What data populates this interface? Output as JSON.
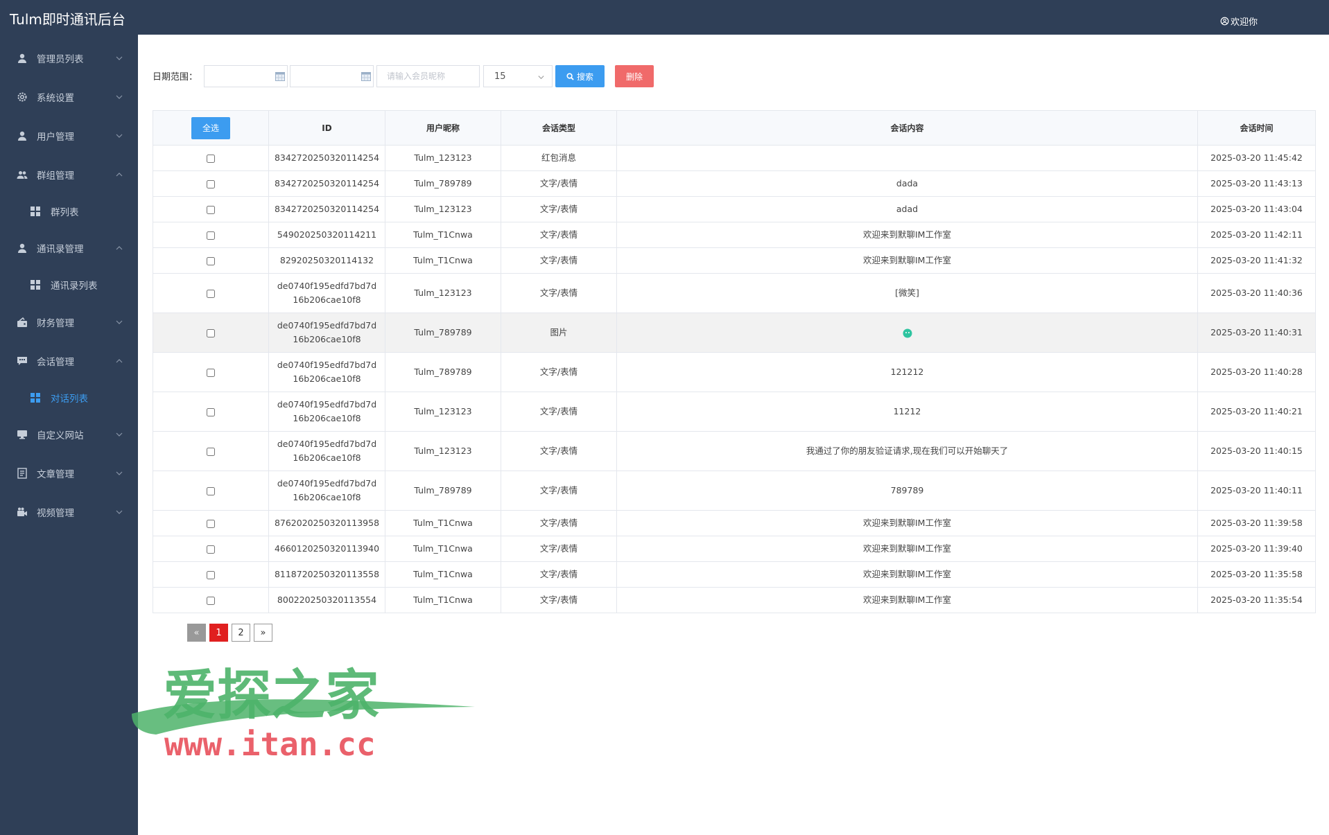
{
  "header": {
    "title": "Tulm即时通讯后台",
    "welcome": "欢迎你"
  },
  "sidebar": {
    "items": [
      {
        "label": "管理员列表",
        "icon": "user-icon",
        "expanded": false
      },
      {
        "label": "系统设置",
        "icon": "gear-icon",
        "expanded": false
      },
      {
        "label": "用户管理",
        "icon": "user-icon",
        "expanded": false
      },
      {
        "label": "群组管理",
        "icon": "group-icon",
        "expanded": true
      },
      {
        "label": "群列表",
        "icon": "grid-icon",
        "sub": true
      },
      {
        "label": "通讯录管理",
        "icon": "user-icon",
        "expanded": true
      },
      {
        "label": "通讯录列表",
        "icon": "grid-icon",
        "sub": true
      },
      {
        "label": "财务管理",
        "icon": "finance-icon",
        "expanded": false
      },
      {
        "label": "会话管理",
        "icon": "chat-icon",
        "expanded": true
      },
      {
        "label": "对话列表",
        "icon": "grid-icon",
        "sub": true,
        "active": true
      },
      {
        "label": "自定义网站",
        "icon": "monitor-icon",
        "expanded": false
      },
      {
        "label": "文章管理",
        "icon": "article-icon",
        "expanded": false
      },
      {
        "label": "视频管理",
        "icon": "video-icon",
        "expanded": false
      }
    ]
  },
  "filter": {
    "date_label": "日期范围：",
    "date_start": "",
    "date_end": "",
    "nickname_placeholder": "请输入会员昵称",
    "page_size": "15",
    "search_label": "搜索",
    "delete_label": "删除"
  },
  "table": {
    "select_all_label": "全选",
    "columns": [
      "ID",
      "用户昵称",
      "会话类型",
      "会话内容",
      "会话时间"
    ],
    "rows": [
      {
        "id": "8342720250320114254",
        "nickname": "Tulm_123123",
        "type": "红包消息",
        "content": "",
        "time": "2025-03-20 11:45:42"
      },
      {
        "id": "8342720250320114254",
        "nickname": "Tulm_789789",
        "type": "文字/表情",
        "content": "dada",
        "time": "2025-03-20 11:43:13"
      },
      {
        "id": "8342720250320114254",
        "nickname": "Tulm_123123",
        "type": "文字/表情",
        "content": "adad",
        "time": "2025-03-20 11:43:04"
      },
      {
        "id": "549020250320114211",
        "nickname": "Tulm_T1Cnwa",
        "type": "文字/表情",
        "content": "欢迎来到默聊IM工作室",
        "time": "2025-03-20 11:42:11"
      },
      {
        "id": "82920250320114132",
        "nickname": "Tulm_T1Cnwa",
        "type": "文字/表情",
        "content": "欢迎来到默聊IM工作室",
        "time": "2025-03-20 11:41:32"
      },
      {
        "id": "de0740f195edfd7bd7d16b206cae10f8",
        "nickname": "Tulm_123123",
        "type": "文字/表情",
        "content": "[微笑]",
        "time": "2025-03-20 11:40:36"
      },
      {
        "id": "de0740f195edfd7bd7d16b206cae10f8",
        "nickname": "Tulm_789789",
        "type": "图片",
        "content": "",
        "image": true,
        "time": "2025-03-20 11:40:31"
      },
      {
        "id": "de0740f195edfd7bd7d16b206cae10f8",
        "nickname": "Tulm_789789",
        "type": "文字/表情",
        "content": "121212",
        "time": "2025-03-20 11:40:28"
      },
      {
        "id": "de0740f195edfd7bd7d16b206cae10f8",
        "nickname": "Tulm_123123",
        "type": "文字/表情",
        "content": "11212",
        "time": "2025-03-20 11:40:21"
      },
      {
        "id": "de0740f195edfd7bd7d16b206cae10f8",
        "nickname": "Tulm_123123",
        "type": "文字/表情",
        "content": "我通过了你的朋友验证请求,现在我们可以开始聊天了",
        "time": "2025-03-20 11:40:15"
      },
      {
        "id": "de0740f195edfd7bd7d16b206cae10f8",
        "nickname": "Tulm_789789",
        "type": "文字/表情",
        "content": "789789",
        "time": "2025-03-20 11:40:11"
      },
      {
        "id": "8762020250320113958",
        "nickname": "Tulm_T1Cnwa",
        "type": "文字/表情",
        "content": "欢迎来到默聊IM工作室",
        "time": "2025-03-20 11:39:58"
      },
      {
        "id": "4660120250320113940",
        "nickname": "Tulm_T1Cnwa",
        "type": "文字/表情",
        "content": "欢迎来到默聊IM工作室",
        "time": "2025-03-20 11:39:40"
      },
      {
        "id": "8118720250320113558",
        "nickname": "Tulm_T1Cnwa",
        "type": "文字/表情",
        "content": "欢迎来到默聊IM工作室",
        "time": "2025-03-20 11:35:58"
      },
      {
        "id": "800220250320113554",
        "nickname": "Tulm_T1Cnwa",
        "type": "文字/表情",
        "content": "欢迎来到默聊IM工作室",
        "time": "2025-03-20 11:35:54"
      }
    ]
  },
  "pagination": {
    "prev": "«",
    "pages": [
      "1",
      "2"
    ],
    "current": "1",
    "next": "»"
  },
  "watermark": {
    "title": "爱探之家",
    "url": "www.itan.cc"
  },
  "colors": {
    "sidebar_bg": "#2f3f57",
    "accent": "#3c9cf0",
    "danger": "#f06a6a",
    "current_page": "#e02020",
    "watermark_green": "#4db36a",
    "watermark_red": "#e8505b"
  }
}
